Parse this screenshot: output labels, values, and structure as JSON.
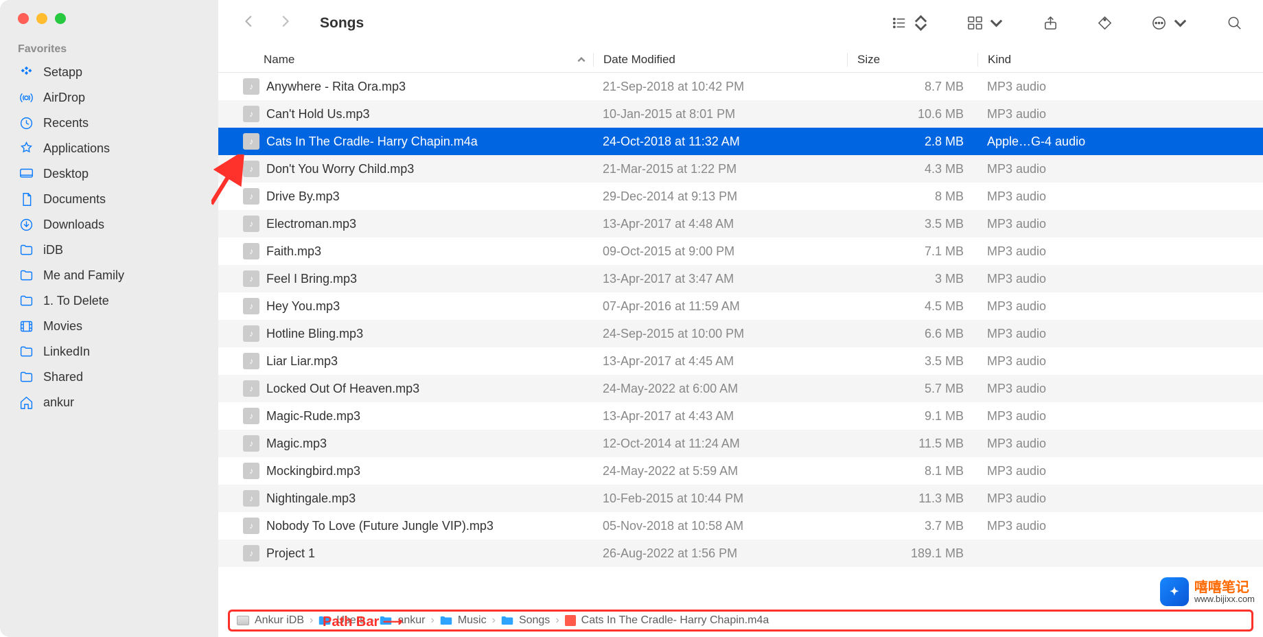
{
  "window_title": "Songs",
  "sidebar": {
    "section": "Favorites",
    "items": [
      {
        "label": "Setapp",
        "icon": "setapp"
      },
      {
        "label": "AirDrop",
        "icon": "airdrop"
      },
      {
        "label": "Recents",
        "icon": "recents"
      },
      {
        "label": "Applications",
        "icon": "applications"
      },
      {
        "label": "Desktop",
        "icon": "desktop"
      },
      {
        "label": "Documents",
        "icon": "documents"
      },
      {
        "label": "Downloads",
        "icon": "downloads"
      },
      {
        "label": "iDB",
        "icon": "folder"
      },
      {
        "label": "Me and Family",
        "icon": "folder"
      },
      {
        "label": "1. To Delete",
        "icon": "folder"
      },
      {
        "label": "Movies",
        "icon": "movies"
      },
      {
        "label": "LinkedIn",
        "icon": "folder"
      },
      {
        "label": "Shared",
        "icon": "folder"
      },
      {
        "label": "ankur",
        "icon": "home"
      }
    ]
  },
  "columns": {
    "name": "Name",
    "date": "Date Modified",
    "size": "Size",
    "kind": "Kind"
  },
  "selected_index": 2,
  "rows": [
    {
      "name": "Anywhere - Rita Ora.mp3",
      "date": "21-Sep-2018 at 10:42 PM",
      "size": "8.7 MB",
      "kind": "MP3 audio"
    },
    {
      "name": "Can't Hold Us.mp3",
      "date": "10-Jan-2015 at 8:01 PM",
      "size": "10.6 MB",
      "kind": "MP3 audio"
    },
    {
      "name": "Cats In The Cradle- Harry Chapin.m4a",
      "date": "24-Oct-2018 at 11:32 AM",
      "size": "2.8 MB",
      "kind": "Apple…G-4 audio"
    },
    {
      "name": "Don't You Worry Child.mp3",
      "date": "21-Mar-2015 at 1:22 PM",
      "size": "4.3 MB",
      "kind": "MP3 audio"
    },
    {
      "name": "Drive By.mp3",
      "date": "29-Dec-2014 at 9:13 PM",
      "size": "8 MB",
      "kind": "MP3 audio"
    },
    {
      "name": "Electroman.mp3",
      "date": "13-Apr-2017 at 4:48 AM",
      "size": "3.5 MB",
      "kind": "MP3 audio"
    },
    {
      "name": "Faith.mp3",
      "date": "09-Oct-2015 at 9:00 PM",
      "size": "7.1 MB",
      "kind": "MP3 audio"
    },
    {
      "name": "Feel I Bring.mp3",
      "date": "13-Apr-2017 at 3:47 AM",
      "size": "3 MB",
      "kind": "MP3 audio"
    },
    {
      "name": "Hey You.mp3",
      "date": "07-Apr-2016 at 11:59 AM",
      "size": "4.5 MB",
      "kind": "MP3 audio"
    },
    {
      "name": "Hotline Bling.mp3",
      "date": "24-Sep-2015 at 10:00 PM",
      "size": "6.6 MB",
      "kind": "MP3 audio"
    },
    {
      "name": "Liar Liar.mp3",
      "date": "13-Apr-2017 at 4:45 AM",
      "size": "3.5 MB",
      "kind": "MP3 audio"
    },
    {
      "name": "Locked Out Of Heaven.mp3",
      "date": "24-May-2022 at 6:00 AM",
      "size": "5.7 MB",
      "kind": "MP3 audio"
    },
    {
      "name": "Magic-Rude.mp3",
      "date": "13-Apr-2017 at 4:43 AM",
      "size": "9.1 MB",
      "kind": "MP3 audio"
    },
    {
      "name": "Magic.mp3",
      "date": "12-Oct-2014 at 11:24 AM",
      "size": "11.5 MB",
      "kind": "MP3 audio"
    },
    {
      "name": "Mockingbird.mp3",
      "date": "24-May-2022 at 5:59 AM",
      "size": "8.1 MB",
      "kind": "MP3 audio"
    },
    {
      "name": "Nightingale.mp3",
      "date": "10-Feb-2015 at 10:44 PM",
      "size": "11.3 MB",
      "kind": "MP3 audio"
    },
    {
      "name": "Nobody To Love (Future Jungle VIP).mp3",
      "date": "05-Nov-2018 at 10:58 AM",
      "size": "3.7 MB",
      "kind": "MP3 audio"
    },
    {
      "name": "Project 1",
      "date": "26-Aug-2022 at 1:56 PM",
      "size": "189.1 MB",
      "kind": ""
    }
  ],
  "pathbar": [
    "Ankur iDB",
    "Users",
    "ankur",
    "Music",
    "Songs",
    "Cats In The Cradle- Harry Chapin.m4a"
  ],
  "annotation_label": "Path Bar",
  "watermark": {
    "zh": "嘻嘻笔记",
    "url": "www.bijixx.com"
  }
}
